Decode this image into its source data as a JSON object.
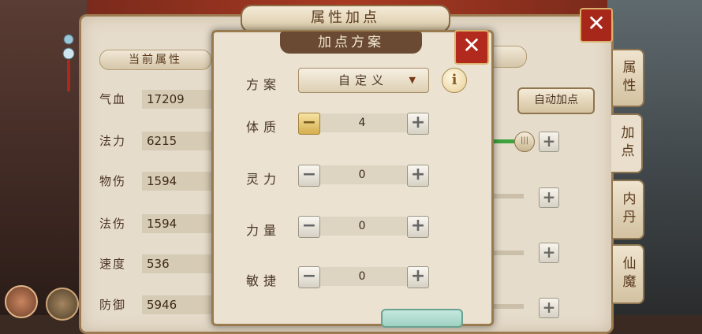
{
  "main_panel": {
    "title": "属性加点",
    "close": "✕",
    "current_attr_label": "当前属性",
    "stats": [
      {
        "label": "气血",
        "value": "17209"
      },
      {
        "label": "法力",
        "value": "6215"
      },
      {
        "label": "物伤",
        "value": "1594"
      },
      {
        "label": "法伤",
        "value": "1594"
      },
      {
        "label": "速度",
        "value": "536"
      },
      {
        "label": "防御",
        "value": "5946"
      }
    ],
    "auto_add_label": "自动加点",
    "side_tabs": [
      "属性",
      "加点",
      "内丹",
      "仙魔"
    ]
  },
  "dialog": {
    "title": "加点方案",
    "close": "✕",
    "scheme_label": "方案",
    "scheme_value": "自定义",
    "info": "i",
    "minus": "−",
    "plus": "+",
    "attributes": [
      {
        "label": "体质",
        "value": "4"
      },
      {
        "label": "灵力",
        "value": "0"
      },
      {
        "label": "力量",
        "value": "0"
      },
      {
        "label": "敏捷",
        "value": "0"
      }
    ]
  },
  "colors": {
    "panel": "#e6dccb",
    "accent_red": "#b22a1d",
    "title_brown": "#6a4a33",
    "green_bar": "#3da33d"
  }
}
